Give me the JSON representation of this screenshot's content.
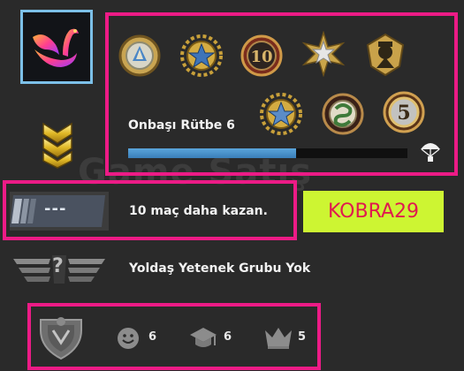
{
  "profile": {
    "avatar_icon": "pink-swan-logo-icon",
    "rank_icon": "chevron-rank-icon"
  },
  "medals": {
    "row1": [
      "silver-coin-medal",
      "gold-star-medal",
      "ten-year-medal",
      "silver-star-medal",
      "gold-soldier-medal"
    ],
    "row2": [
      "blue-star-medal",
      "snake-coin-medal",
      "service-5-medal"
    ]
  },
  "rank": {
    "label": "Onbaşı Rütbe 6",
    "progress": 0.6,
    "parachute_icon": "parachute-drop-icon"
  },
  "watermark": "Game Satış",
  "wins": {
    "icon": "skill-bars-icon",
    "message": "10 maç daha kazan.",
    "icon_text": "---"
  },
  "banner": {
    "text": "KOBRA29",
    "bg": "#cdf532",
    "color": "#e0194f"
  },
  "skill_group": {
    "icon": "question-wings-icon",
    "icon_text": "?",
    "message": "Yoldaş Yetenek Grubu Yok"
  },
  "stats": {
    "badge_icon": "crest-badge-icon",
    "friendly": "6",
    "teacher": "6",
    "leader": "5"
  },
  "colors": {
    "highlight": "#ec1b86",
    "avatar_border": "#7cc0e8",
    "xp_fill": "#4a94cf"
  }
}
